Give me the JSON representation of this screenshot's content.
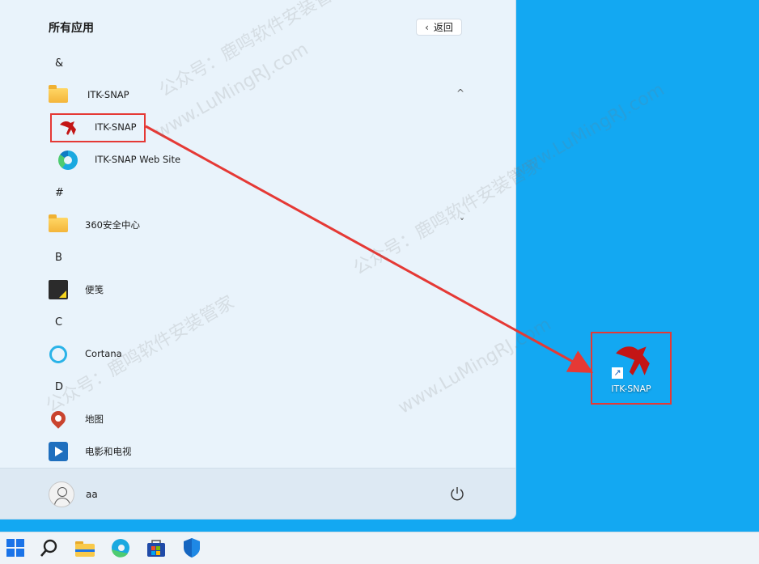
{
  "start_menu": {
    "title": "所有应用",
    "back_label": "返回",
    "sections": [
      {
        "letter": "&"
      },
      {
        "letter": "#"
      },
      {
        "letter": "B"
      },
      {
        "letter": "C"
      },
      {
        "letter": "D"
      }
    ],
    "apps": {
      "itk_folder": "ITK-SNAP",
      "itk_app": "ITK-SNAP",
      "itk_web": "ITK-SNAP Web Site",
      "folder_360": "360安全中心",
      "sticky": "便笺",
      "cortana": "Cortana",
      "maps": "地图",
      "movies": "电影和电视"
    },
    "user": {
      "name": "aa"
    }
  },
  "desktop": {
    "icon_label": "ITK-SNAP"
  },
  "watermark": {
    "line1": "公众号：鹿鸣软件安装管家",
    "line2": "www.LuMingRJ.com"
  },
  "colors": {
    "desktop_bg": "#13a8f2",
    "menu_bg": "#e9f3fb",
    "highlight": "#e53935",
    "arrow": "#e53935"
  }
}
